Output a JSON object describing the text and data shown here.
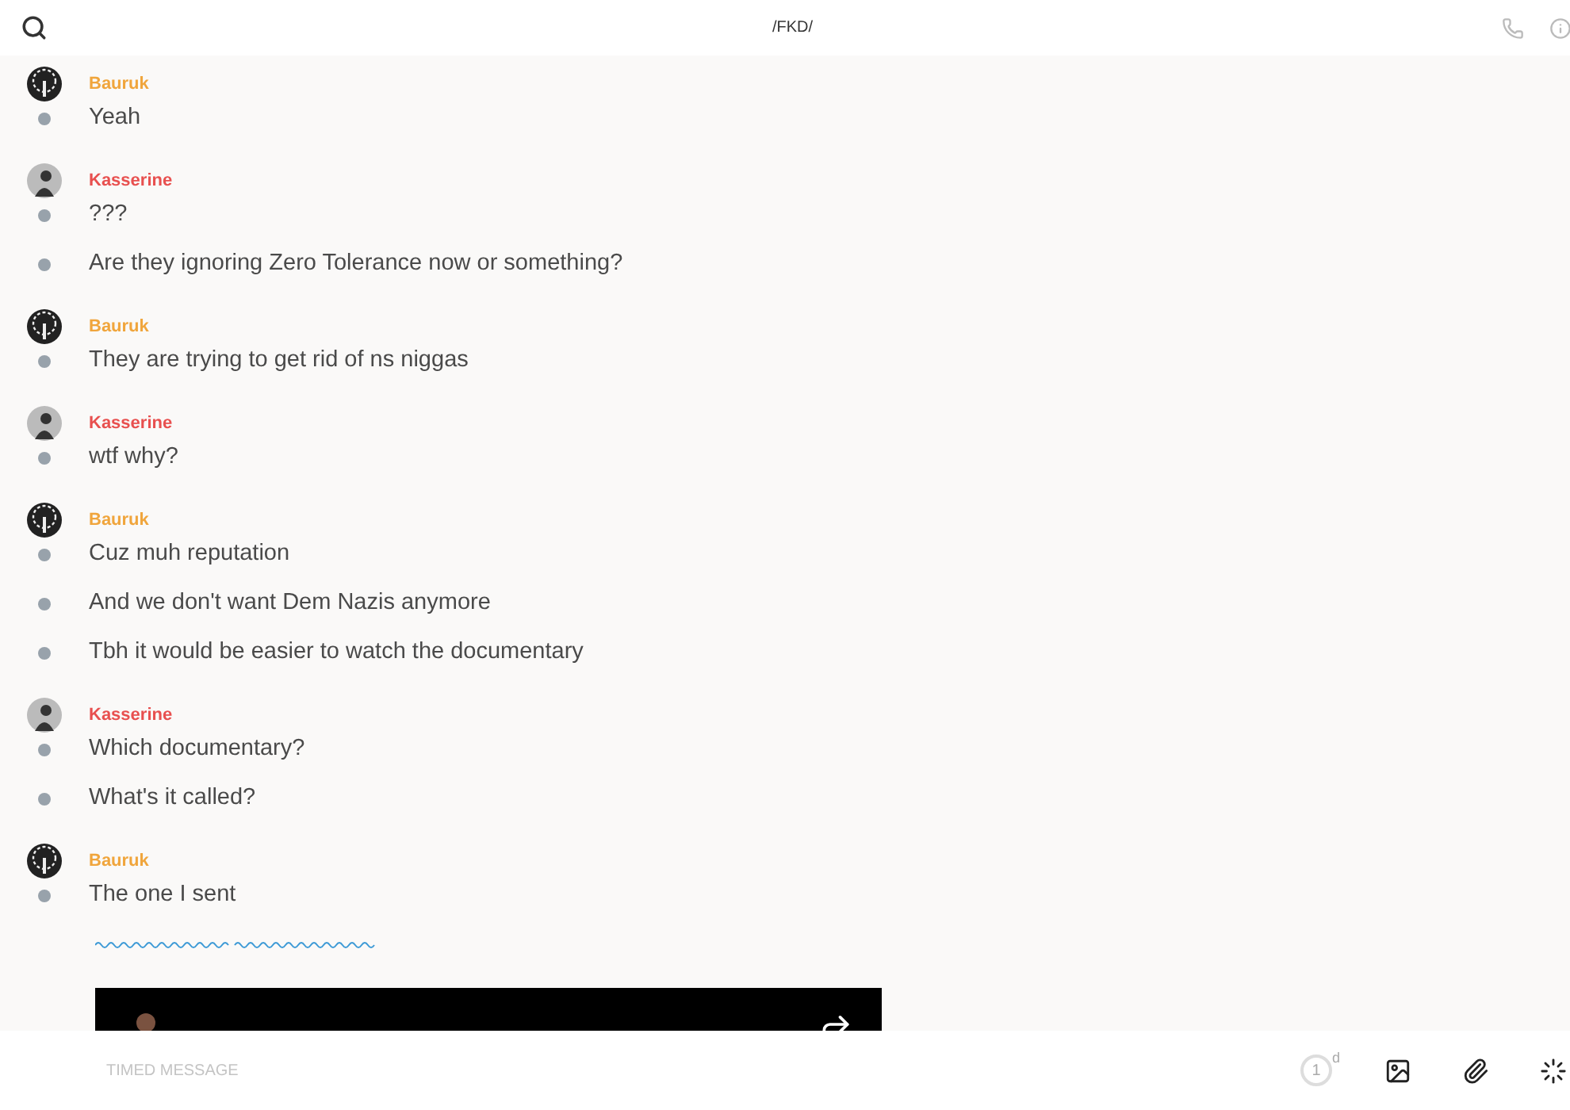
{
  "header": {
    "title": "/FKD/"
  },
  "groups": [
    {
      "sender": "Bauruk",
      "color": "#f0a53c",
      "avatar": {
        "kind": "tree"
      },
      "messages": [
        {
          "kind": "text",
          "text": "Yeah"
        }
      ]
    },
    {
      "sender": "Kasserine",
      "color": "#e8504f",
      "avatar": {
        "kind": "figure"
      },
      "messages": [
        {
          "kind": "text",
          "text": "???"
        },
        {
          "kind": "text",
          "text": "Are they ignoring Zero Tolerance now or something?"
        }
      ]
    },
    {
      "sender": "Bauruk",
      "color": "#f0a53c",
      "avatar": {
        "kind": "tree"
      },
      "messages": [
        {
          "kind": "text",
          "text": "They are trying to get rid of ns niggas"
        }
      ]
    },
    {
      "sender": "Kasserine",
      "color": "#e8504f",
      "avatar": {
        "kind": "figure"
      },
      "messages": [
        {
          "kind": "text",
          "text": "wtf why?"
        }
      ]
    },
    {
      "sender": "Bauruk",
      "color": "#f0a53c",
      "avatar": {
        "kind": "tree"
      },
      "messages": [
        {
          "kind": "text",
          "text": "Cuz muh reputation"
        },
        {
          "kind": "text",
          "text": "And we don't want Dem Nazis anymore"
        },
        {
          "kind": "text",
          "text": "Tbh it would be easier to watch the documentary"
        }
      ]
    },
    {
      "sender": "Kasserine",
      "color": "#e8504f",
      "avatar": {
        "kind": "figure"
      },
      "messages": [
        {
          "kind": "text",
          "text": "Which documentary?"
        },
        {
          "kind": "text",
          "text": "What's it called?"
        }
      ]
    },
    {
      "sender": "Bauruk",
      "color": "#f0a53c",
      "avatar": {
        "kind": "tree"
      },
      "messages": [
        {
          "kind": "text",
          "text": "The one I sent"
        },
        {
          "kind": "link"
        },
        {
          "kind": "video"
        }
      ]
    }
  ],
  "composer": {
    "placeholder": "TIMED MESSAGE",
    "timer": "1",
    "timer_unit": "d"
  }
}
